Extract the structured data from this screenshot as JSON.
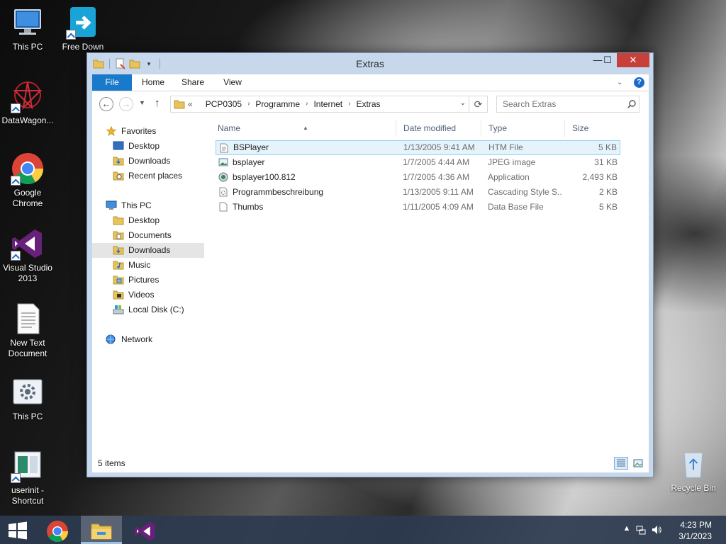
{
  "desktop": {
    "icons": [
      {
        "label": "This PC"
      },
      {
        "label": "Free Down"
      },
      {
        "label": "DataWagon..."
      },
      {
        "label": "Google Chrome"
      },
      {
        "label": "Visual Studio 2013"
      },
      {
        "label": "New Text Document"
      },
      {
        "label": "This PC"
      },
      {
        "label": "userinit - Shortcut"
      }
    ],
    "recycle_bin": "Recycle Bin"
  },
  "window": {
    "title": "Extras",
    "controls": {
      "minimize": "—",
      "maximize": "☐",
      "close": "✕"
    }
  },
  "ribbon": {
    "tabs": [
      "File",
      "Home",
      "Share",
      "View"
    ]
  },
  "address": {
    "overflow": "«",
    "crumbs": [
      "PCP0305",
      "Programme",
      "Internet",
      "Extras"
    ],
    "search_placeholder": "Search Extras"
  },
  "nav": {
    "favorites": "Favorites",
    "fav_items": [
      "Desktop",
      "Downloads",
      "Recent places"
    ],
    "this_pc": "This PC",
    "pc_items": [
      "Desktop",
      "Documents",
      "Downloads",
      "Music",
      "Pictures",
      "Videos",
      "Local Disk (C:)"
    ],
    "network": "Network",
    "selected": "Downloads"
  },
  "files": {
    "columns": [
      "Name",
      "Date modified",
      "Type",
      "Size"
    ],
    "rows": [
      {
        "name": "BSPlayer",
        "date": "1/13/2005 9:41 AM",
        "type": "HTM File",
        "size": "5 KB"
      },
      {
        "name": "bsplayer",
        "date": "1/7/2005 4:44 AM",
        "type": "JPEG image",
        "size": "31 KB"
      },
      {
        "name": "bsplayer100.812",
        "date": "1/7/2005 4:36 AM",
        "type": "Application",
        "size": "2,493 KB"
      },
      {
        "name": "Programmbeschreibung",
        "date": "1/13/2005 9:11 AM",
        "type": "Cascading Style S...",
        "size": "2 KB"
      },
      {
        "name": "Thumbs",
        "date": "1/11/2005 4:09 AM",
        "type": "Data Base File",
        "size": "5 KB"
      }
    ]
  },
  "status": {
    "count": "5 items"
  },
  "taskbar": {
    "time": "4:23 PM",
    "date": "3/1/2023"
  },
  "colors": {
    "accent": "#1979ca",
    "close": "#c7403a",
    "selection": "#e5f3fb",
    "window_frame": "#c7d8ec"
  }
}
